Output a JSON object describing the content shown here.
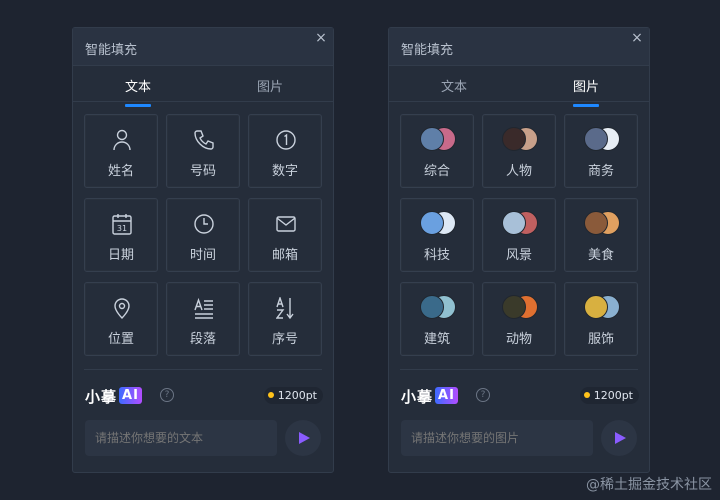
{
  "left_panel": {
    "title": "智能填充",
    "close": "×",
    "tabs": [
      {
        "label": "文本",
        "active": true
      },
      {
        "label": "图片",
        "active": false
      }
    ],
    "cells": [
      {
        "label": "姓名",
        "icon": "person-icon"
      },
      {
        "label": "号码",
        "icon": "phone-icon"
      },
      {
        "label": "数字",
        "icon": "number-icon"
      },
      {
        "label": "日期",
        "icon": "calendar-icon"
      },
      {
        "label": "时间",
        "icon": "clock-icon"
      },
      {
        "label": "邮箱",
        "icon": "mail-icon"
      },
      {
        "label": "位置",
        "icon": "location-pin-icon"
      },
      {
        "label": "段落",
        "icon": "paragraph-icon"
      },
      {
        "label": "序号",
        "icon": "sort-az-icon"
      }
    ],
    "brand": "小摹",
    "brand_ai": "AI",
    "help": "?",
    "points": "1200pt",
    "prompt_placeholder": "请描述你想要的文本"
  },
  "right_panel": {
    "title": "智能填充",
    "close": "×",
    "tabs": [
      {
        "label": "文本",
        "active": false
      },
      {
        "label": "图片",
        "active": true
      }
    ],
    "cells": [
      {
        "label": "综合",
        "icon": "mixed-photos-icon",
        "colors": [
          "#5f7fa8",
          "#c86a8a"
        ]
      },
      {
        "label": "人物",
        "icon": "people-photos-icon",
        "colors": [
          "#3a2a2a",
          "#c8a08a"
        ]
      },
      {
        "label": "商务",
        "icon": "business-photos-icon",
        "colors": [
          "#5a6a8a",
          "#e8eef5"
        ]
      },
      {
        "label": "科技",
        "icon": "tech-photos-icon",
        "colors": [
          "#6aa0e0",
          "#dde8f5"
        ]
      },
      {
        "label": "风景",
        "icon": "landscape-photos-icon",
        "colors": [
          "#a8c0d8",
          "#c06060"
        ]
      },
      {
        "label": "美食",
        "icon": "food-photos-icon",
        "colors": [
          "#8a5a3a",
          "#e0a060"
        ]
      },
      {
        "label": "建筑",
        "icon": "architecture-photos-icon",
        "colors": [
          "#3a6a8a",
          "#90c0d0"
        ]
      },
      {
        "label": "动物",
        "icon": "animal-photos-icon",
        "colors": [
          "#3a3a2a",
          "#e07030"
        ]
      },
      {
        "label": "服饰",
        "icon": "fashion-photos-icon",
        "colors": [
          "#d8b040",
          "#8ab0d0"
        ]
      }
    ],
    "brand": "小摹",
    "brand_ai": "AI",
    "help": "?",
    "points": "1200pt",
    "prompt_placeholder": "请描述你想要的图片"
  },
  "watermark": "@稀土掘金技术社区",
  "colors": {
    "accent": "#1e88ff",
    "send": "#8a5cff",
    "points_dot": "#ffc21a"
  }
}
